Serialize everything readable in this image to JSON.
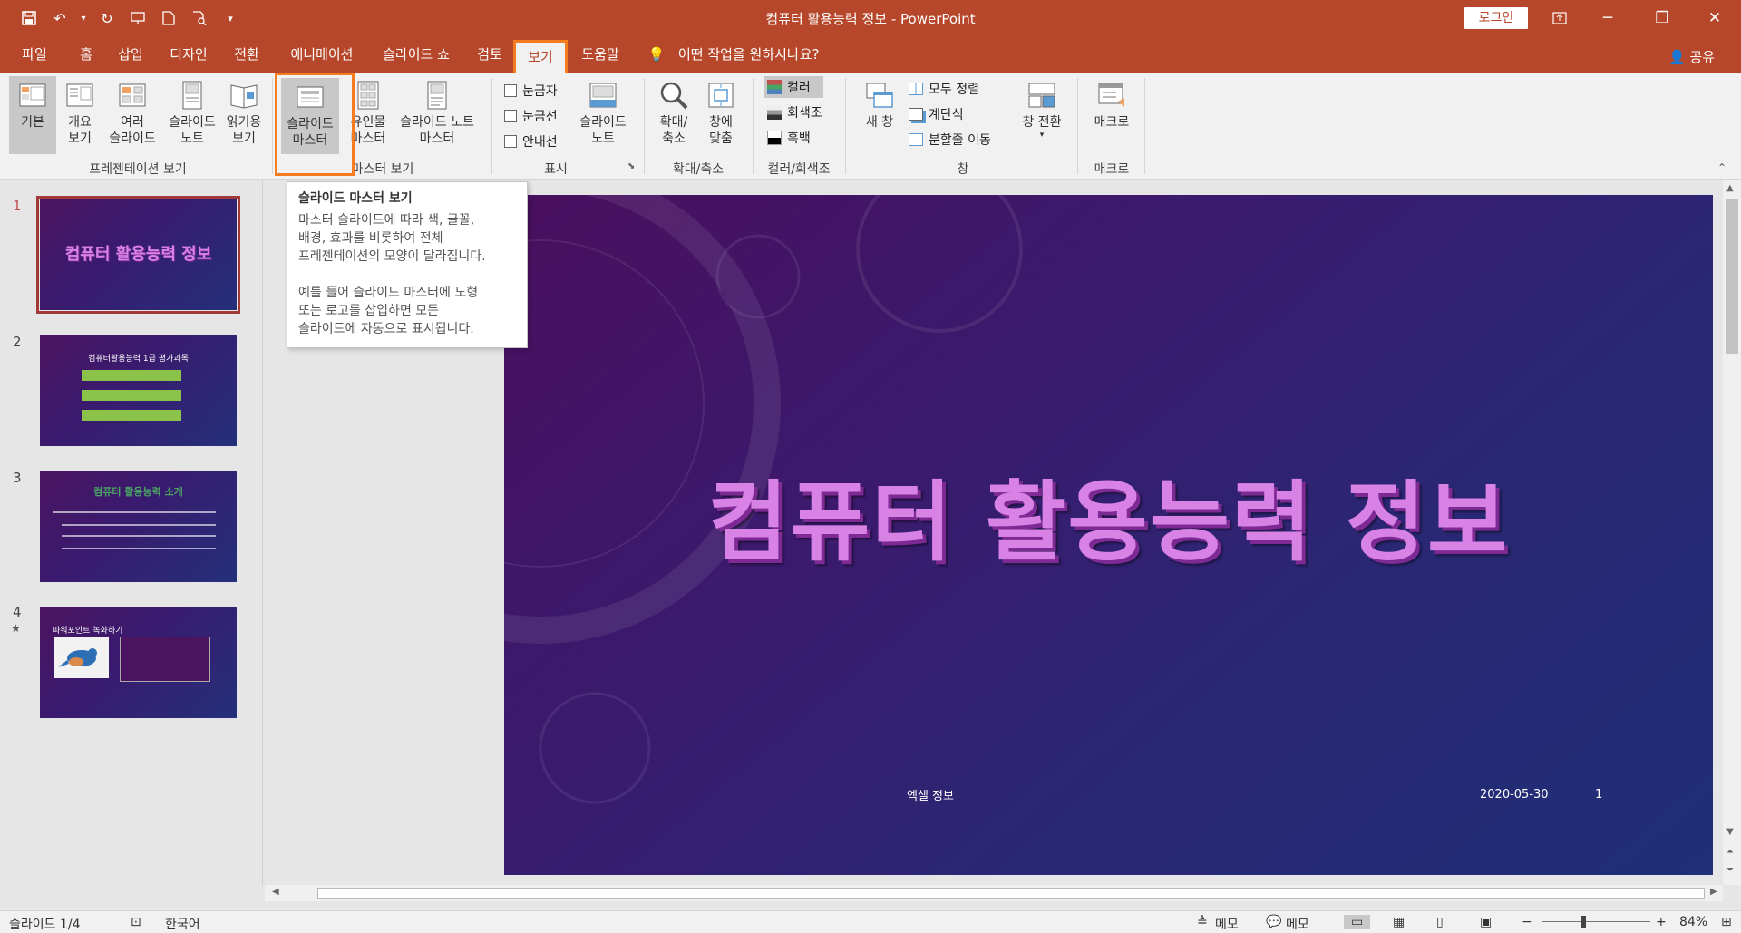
{
  "window": {
    "title": "컴퓨터 활용능력 정보  -  PowerPoint",
    "login": "로그인"
  },
  "tabs": [
    {
      "label": "파일"
    },
    {
      "label": "홈"
    },
    {
      "label": "삽입"
    },
    {
      "label": "디자인"
    },
    {
      "label": "전환"
    },
    {
      "label": "애니메이션"
    },
    {
      "label": "슬라이드 쇼"
    },
    {
      "label": "검토"
    },
    {
      "label": "보기"
    },
    {
      "label": "도움말"
    }
  ],
  "tell_me": "어떤 작업을 원하시나요?",
  "share": "공유",
  "ribbon": {
    "views": {
      "normal": "기본",
      "outline_1": "개요",
      "outline_2": "보기",
      "sorter_1": "여러",
      "sorter_2": "슬라이드",
      "notes_1": "슬라이드",
      "notes_2": "노트",
      "reading_1": "읽기용",
      "reading_2": "보기",
      "group": "프레젠테이션 보기"
    },
    "master": {
      "slide_1": "슬라이드",
      "slide_2": "마스터",
      "handout_1": "유인물",
      "handout_2": "마스터",
      "notes_1": "슬라이드 노트",
      "notes_2": "마스터",
      "group": "마스터 보기"
    },
    "show": {
      "ruler": "눈금자",
      "gridlines": "눈금선",
      "guides": "안내선",
      "notes_1": "슬라이드",
      "notes_2": "노트",
      "group": "표시"
    },
    "zoom": {
      "zoom_1": "확대/",
      "zoom_2": "축소",
      "fit_1": "창에",
      "fit_2": "맞춤",
      "group": "확대/축소"
    },
    "color": {
      "color": "컬러",
      "gray": "회색조",
      "bw": "흑백",
      "group": "컬러/회색조"
    },
    "window": {
      "new": "새 창",
      "arrange": "모두 정렬",
      "cascade": "계단식",
      "split": "분할줄 이동",
      "switch": "창 전환",
      "group": "창"
    },
    "macro": {
      "macro": "매크로",
      "group": "매크로"
    }
  },
  "tooltip": {
    "title": "슬라이드 마스터 보기",
    "p1_l1": "마스터 슬라이드에 따라 색, 글꼴,",
    "p1_l2": "배경, 효과를 비롯하여 전체",
    "p1_l3": "프레젠테이션의 모양이 달라집니다.",
    "p2_l1": "예를 들어 슬라이드 마스터에 도형",
    "p2_l2": "또는 로고를 삽입하면 모든",
    "p2_l3": "슬라이드에 자동으로 표시됩니다."
  },
  "thumbnails": [
    {
      "num": "1",
      "title": "컴퓨터 활용능력 정보"
    },
    {
      "num": "2",
      "title": "컴퓨터활용능력 1급 평가과목"
    },
    {
      "num": "3",
      "title": "컴퓨터 활용능력 소개"
    },
    {
      "num": "4",
      "title": "파워포인트 녹화하기",
      "star": "★"
    }
  ],
  "slide": {
    "title": "컴퓨터 활용능력 정보",
    "footer": "엑셀 정보",
    "date": "2020-05-30",
    "page": "1"
  },
  "status": {
    "slide": "슬라이드 1/4",
    "lang": "한국어",
    "notes": "메모",
    "comments": "메모",
    "zoom": "84%"
  },
  "colors": {
    "accent": "#b7472a",
    "highlight": "#f57c1f",
    "title_pink": "#d882e6"
  }
}
